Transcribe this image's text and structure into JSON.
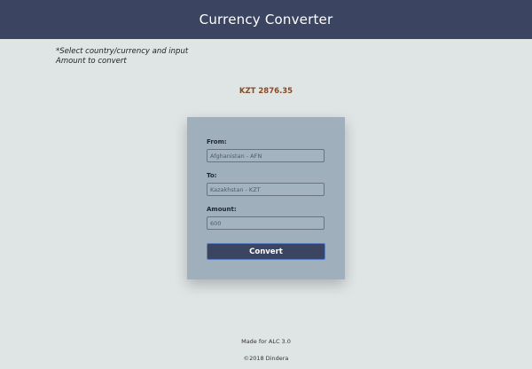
{
  "header": {
    "title": "Currency Converter"
  },
  "instructions": {
    "text": "*Select country/currency and input Amount to convert"
  },
  "result": {
    "text": "KZT 2876.35"
  },
  "form": {
    "from_label": "From:",
    "from_value": "Afghanistan - AFN",
    "to_label": "To:",
    "to_value": "Kazakhstan - KZT",
    "amount_label": "Amount:",
    "amount_value": "600",
    "convert_label": "Convert"
  },
  "footer": {
    "made_for": "Made for ALC 3.0",
    "copyright": "©2018 Dindera"
  },
  "colors": {
    "header_bg": "#3b4460",
    "page_bg": "#dfe4e4",
    "card_bg": "#9fb0bc",
    "result_text": "#8b4a22"
  }
}
